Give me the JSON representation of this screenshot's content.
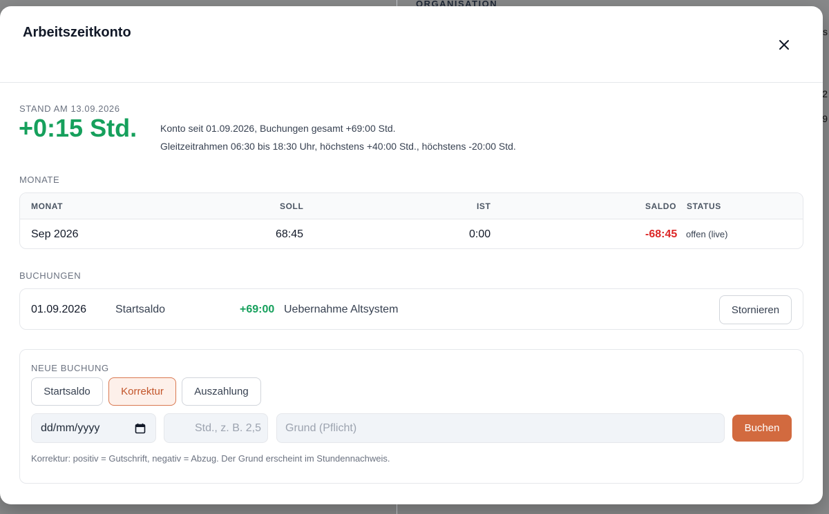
{
  "background": {
    "section_label": "ORGANISATION",
    "edge_texts": [
      "us",
      "2",
      "9"
    ]
  },
  "modal": {
    "title": "Arbeitszeitkonto",
    "close_icon": "close-icon"
  },
  "summary": {
    "stand_label": "STAND AM 13.09.2026",
    "saldo": "+0:15 Std.",
    "saldo_color": "#16a05c",
    "info_line_1": "Konto seit 01.09.2026, Buchungen gesamt +69:00 Std.",
    "info_line_2": "Gleitzeitrahmen 06:30 bis 18:30 Uhr, höchstens +40:00 Std., höchstens -20:00 Std."
  },
  "months": {
    "section_label": "MONATE",
    "headers": [
      "MONAT",
      "SOLL",
      "IST",
      "SALDO",
      "STATUS"
    ],
    "rows": [
      {
        "month": "Sep 2026",
        "soll": "68:45",
        "ist": "0:00",
        "saldo": "-68:45",
        "status": "offen (live)"
      }
    ]
  },
  "bookings": {
    "section_label": "BUCHUNGEN",
    "rows": [
      {
        "date": "01.09.2026",
        "type": "Startsaldo",
        "amount": "+69:00",
        "reason": "Uebernahme Altsystem",
        "action": "Stornieren"
      }
    ]
  },
  "new_booking": {
    "section_label": "NEUE BUCHUNG",
    "types": [
      "Startsaldo",
      "Korrektur",
      "Auszahlung"
    ],
    "selected_type": "Korrektur",
    "date_value": "dd/mm/yyyy",
    "hours_placeholder": "Std., z. B. 2,5",
    "reason_placeholder": "Grund (Pflicht)",
    "submit_label": "Buchen",
    "hint": "Korrektur: positiv = Gutschrift, negativ = Abzug. Der Grund erscheint im Stundennachweis.",
    "accent_color": "#d26a3f"
  }
}
